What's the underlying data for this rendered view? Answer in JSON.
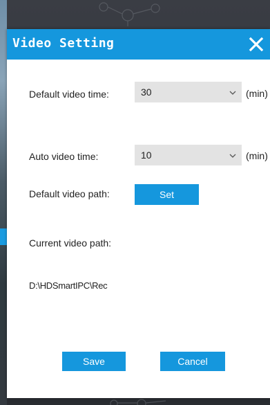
{
  "dialog": {
    "title": "Video Setting",
    "close_icon": "close-icon"
  },
  "default_video_time": {
    "label": "Default video time:",
    "value": "30",
    "unit": "(min)",
    "icon": "chevron-down-icon"
  },
  "auto_video_time": {
    "label": "Auto video time:",
    "value": "10",
    "unit": "(min)",
    "icon": "chevron-down-icon"
  },
  "default_video_path": {
    "label": "Default video path:",
    "set_label": "Set"
  },
  "current_video_path": {
    "label": "Current video path:",
    "value": "D:\\HDSmartIPC\\Rec"
  },
  "footer": {
    "save_label": "Save",
    "cancel_label": "Cancel"
  },
  "colors": {
    "accent": "#1597dd",
    "select_bg": "#e3e3e3",
    "dialog_bg": "#ffffff"
  }
}
